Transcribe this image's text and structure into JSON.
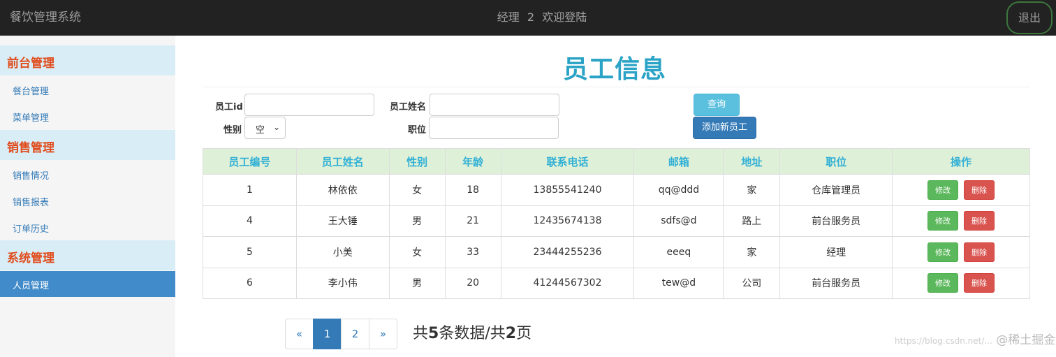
{
  "app": {
    "title": "餐饮管理系统",
    "user_role": "经理",
    "user_id": "2",
    "welcome": "欢迎登陆",
    "logout_label": "退出"
  },
  "sidebar": {
    "groups": [
      {
        "label": "前台管理",
        "items": [
          {
            "label": "餐台管理"
          },
          {
            "label": "菜单管理"
          }
        ]
      },
      {
        "label": "销售管理",
        "items": [
          {
            "label": "销售情况"
          },
          {
            "label": "销售报表"
          },
          {
            "label": "订单历史"
          }
        ]
      },
      {
        "label": "系统管理",
        "items": [
          {
            "label": "人员管理",
            "active": true
          }
        ]
      }
    ]
  },
  "main": {
    "title": "员工信息",
    "form": {
      "id_label": "员工id",
      "id_value": "",
      "name_label": "员工姓名",
      "name_value": "",
      "gender_label": "性别",
      "gender_value": "空",
      "position_label": "职位",
      "position_value": "",
      "query_label": "查询",
      "add_label": "添加新员工"
    },
    "table": {
      "headers": [
        "员工编号",
        "员工姓名",
        "性别",
        "年龄",
        "联系电话",
        "邮箱",
        "地址",
        "职位",
        "操作"
      ],
      "rows": [
        [
          "1",
          "林依依",
          "女",
          "18",
          "13855541240",
          "qq@ddd",
          "家",
          "仓库管理员"
        ],
        [
          "4",
          "王大锤",
          "男",
          "21",
          "12435674138",
          "sdfs@d",
          "路上",
          "前台服务员"
        ],
        [
          "5",
          "小美",
          "女",
          "33",
          "23444255236",
          "eeeq",
          "家",
          "经理"
        ],
        [
          "6",
          "李小伟",
          "男",
          "20",
          "41244567302",
          "tew@d",
          "公司",
          "前台服务员"
        ]
      ],
      "edit_label": "修改",
      "delete_label": "删除"
    },
    "pagination": {
      "prev": "«",
      "pages": [
        "1",
        "2"
      ],
      "current": "1",
      "next": "»"
    },
    "summary": {
      "prefix": "共",
      "total": "5",
      "mid": "条数据/共",
      "pages": "2",
      "suffix": "页"
    }
  },
  "watermark": {
    "text": "@稀土掘金技术社区",
    "url_fragment": "https://blog.csdn.net/..."
  },
  "colors": {
    "topbar": "#222222",
    "accent": "#2aa3c6",
    "group_title": "#e04c1c",
    "active_item": "#428bca"
  }
}
